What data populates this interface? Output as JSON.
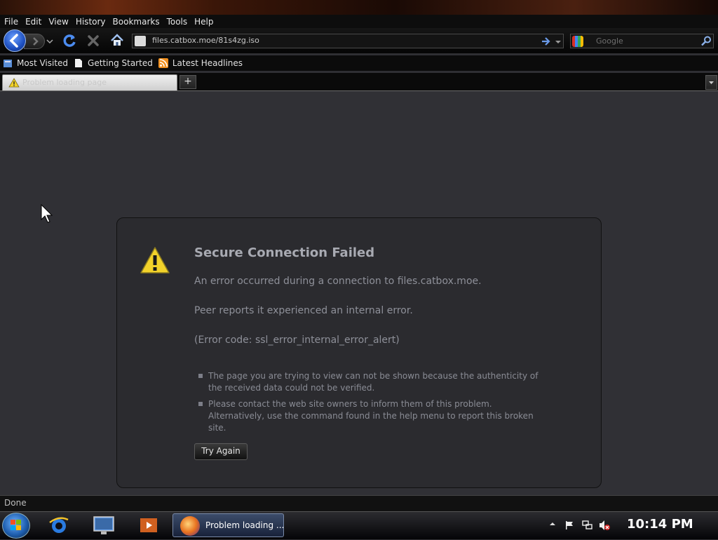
{
  "menu": [
    "File",
    "Edit",
    "View",
    "History",
    "Bookmarks",
    "Tools",
    "Help"
  ],
  "url": "files.catbox.moe/81s4zg.iso",
  "search": {
    "placeholder": "Google"
  },
  "bookmarks": [
    "Most Visited",
    "Getting Started",
    "Latest Headlines"
  ],
  "tab": {
    "title": "Problem loading page",
    "new_tab_label": "+"
  },
  "error": {
    "title": "Secure Connection Failed",
    "line1": "An error occurred during a connection to files.catbox.moe.",
    "line2": "Peer reports it experienced an internal error.",
    "line3": "(Error code: ssl_error_internal_error_alert)",
    "bullets": [
      "The page you are trying to view can not be shown because the authenticity of the received data could not be verified.",
      "Please contact the web site owners to inform them of this problem. Alternatively, use the command found in the help menu to report this broken site."
    ],
    "button": "Try Again"
  },
  "status": "Done",
  "taskbar": {
    "active_window": "Problem loading ...",
    "clock": "10:14 PM"
  },
  "colors": {
    "accent": "#1d4fc0",
    "warning": "#f2d22a",
    "content_bg": "#303035"
  }
}
